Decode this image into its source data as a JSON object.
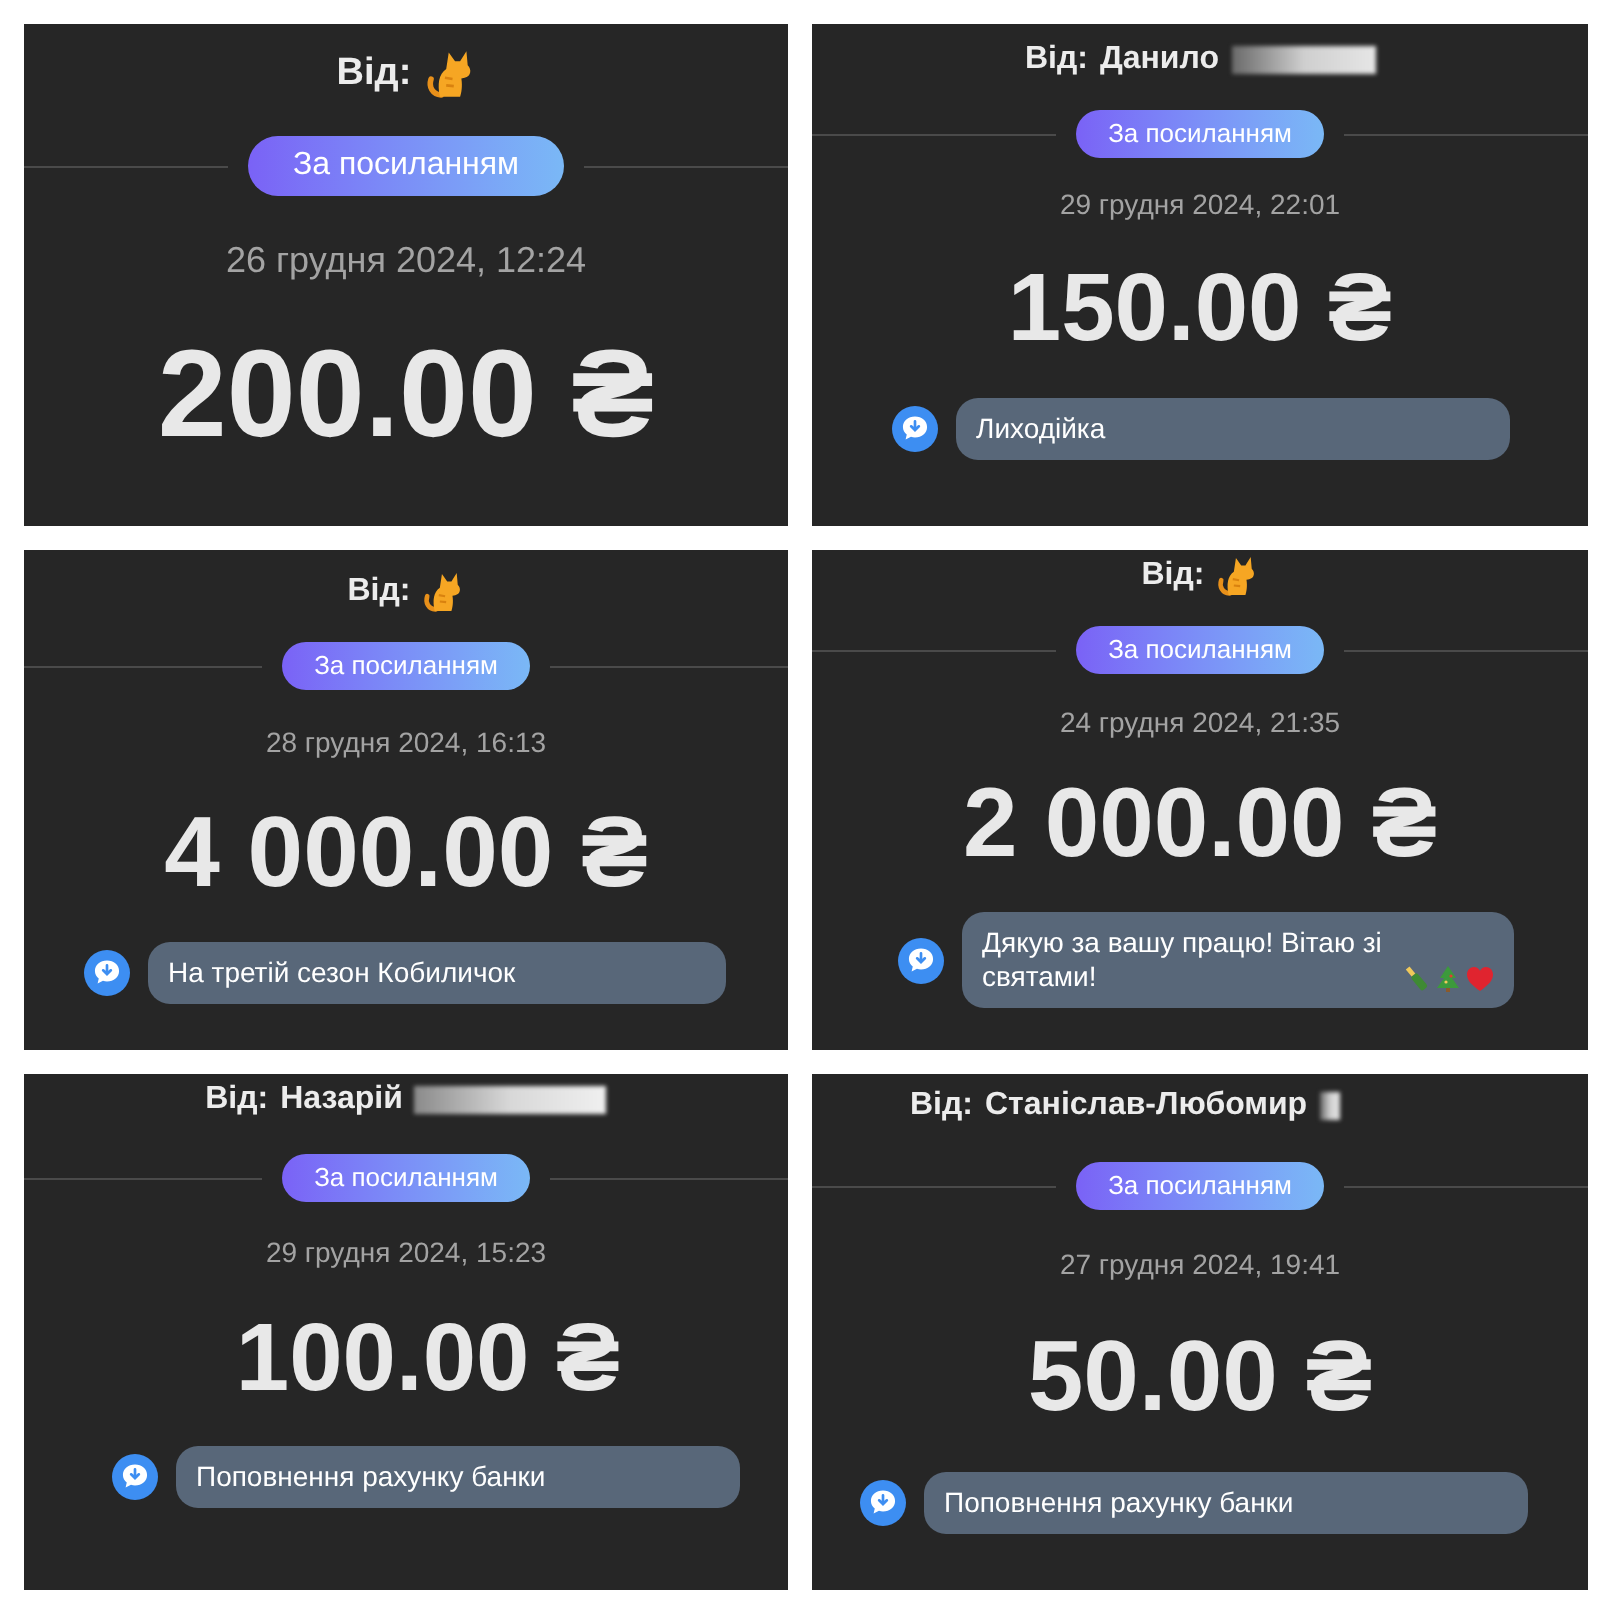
{
  "payments": [
    {
      "sender": {
        "label": "Від:",
        "kind": "icon"
      },
      "badge": "За посиланням",
      "date": "26 грудня 2024, 12:24",
      "amount": "200.00 ₴"
    },
    {
      "sender": {
        "label": "Від:",
        "kind": "name",
        "name": "Данило",
        "redacted": true
      },
      "badge": "За посиланням",
      "date": "29 грудня 2024, 22:01",
      "amount": "150.00 ₴",
      "message": {
        "text": "Лиходійка",
        "has_emojis": false
      }
    },
    {
      "sender": {
        "label": "Від:",
        "kind": "icon"
      },
      "badge": "За посиланням",
      "date": "28 грудня 2024, 16:13",
      "amount": "4 000.00 ₴",
      "message": {
        "text": "На третій сезон Кобиличок",
        "has_emojis": false
      }
    },
    {
      "sender": {
        "label": "Від:",
        "kind": "icon"
      },
      "badge": "За посиланням",
      "date": "24 грудня 2024, 21:35",
      "amount": "2 000.00 ₴",
      "message": {
        "text": "Дякую за вашу працю! Вітаю зі святами!",
        "has_emojis": true
      }
    },
    {
      "sender": {
        "label": "Від:",
        "kind": "name",
        "name": "Назарій",
        "redacted": true
      },
      "badge": "За посиланням",
      "date": "29 грудня 2024, 15:23",
      "amount": "100.00 ₴",
      "message": {
        "text": "Поповнення рахунку банки",
        "has_emojis": false
      }
    },
    {
      "sender": {
        "label": "Від:",
        "kind": "name",
        "name": "Станіслав-Любомир",
        "redacted": true
      },
      "badge": "За посиланням",
      "date": "27 грудня 2024, 19:41",
      "amount": "50.00 ₴",
      "message": {
        "text": "Поповнення рахунку банки",
        "has_emojis": false
      }
    }
  ]
}
